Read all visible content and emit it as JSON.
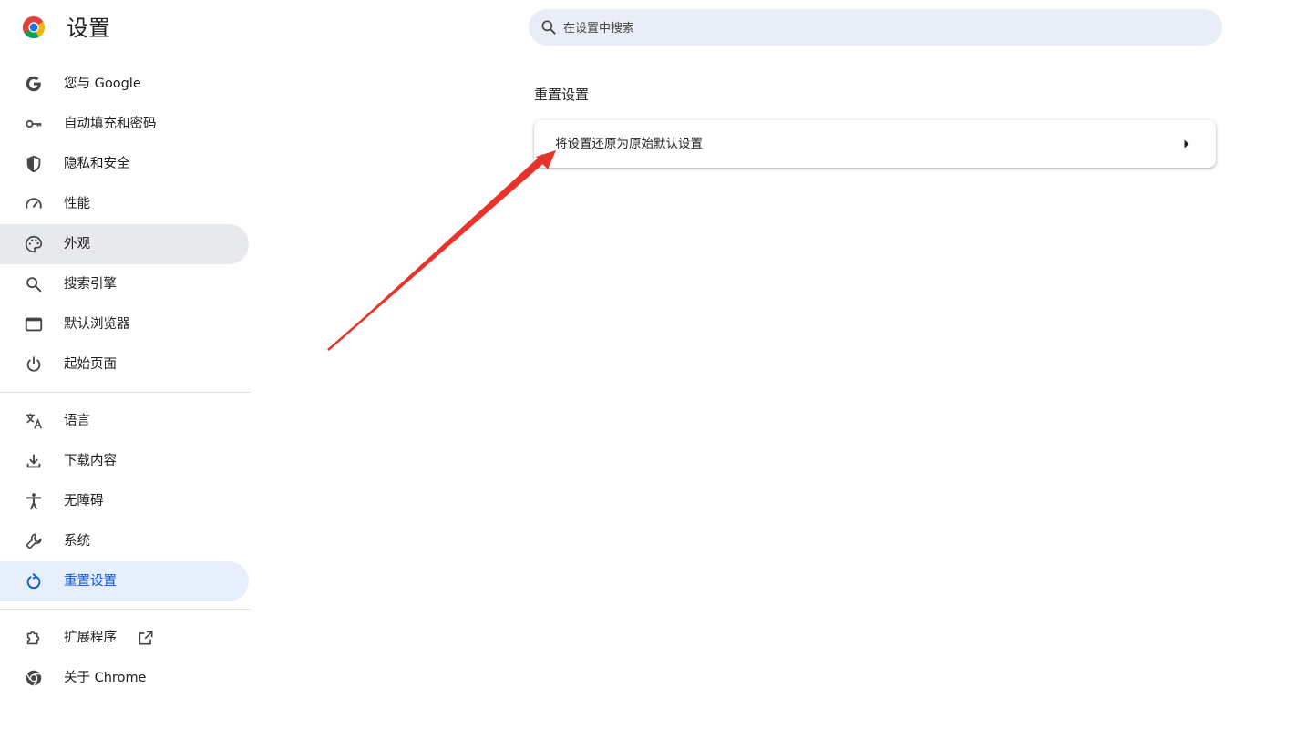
{
  "app": {
    "title": "设置"
  },
  "search": {
    "placeholder": "在设置中搜索",
    "value": ""
  },
  "sidebar": {
    "group1": [
      {
        "label": "您与 Google",
        "icon": "google-icon"
      },
      {
        "label": "自动填充和密码",
        "icon": "key-icon"
      },
      {
        "label": "隐私和安全",
        "icon": "shield-icon"
      },
      {
        "label": "性能",
        "icon": "speedometer-icon"
      },
      {
        "label": "外观",
        "icon": "palette-icon",
        "state": "hover"
      },
      {
        "label": "搜索引擎",
        "icon": "search-icon"
      },
      {
        "label": "默认浏览器",
        "icon": "browser-window-icon"
      },
      {
        "label": "起始页面",
        "icon": "power-icon"
      }
    ],
    "group2": [
      {
        "label": "语言",
        "icon": "translate-icon"
      },
      {
        "label": "下载内容",
        "icon": "download-icon"
      },
      {
        "label": "无障碍",
        "icon": "accessibility-icon"
      },
      {
        "label": "系统",
        "icon": "wrench-icon"
      },
      {
        "label": "重置设置",
        "icon": "reset-icon",
        "state": "active"
      }
    ],
    "group3": [
      {
        "label": "扩展程序",
        "icon": "puzzle-icon",
        "trailing_icon": "open-in-new-icon"
      },
      {
        "label": "关于 Chrome",
        "icon": "chrome-icon"
      }
    ]
  },
  "main": {
    "section_title": "重置设置",
    "rows": [
      {
        "label": "将设置还原为原始默认设置",
        "icon": "arrow-right-icon"
      }
    ]
  },
  "colors": {
    "accent": "#0b57d0",
    "active_bg": "#e7eefc",
    "hover_bg": "#e8e9ec",
    "search_bg": "#e9edf7",
    "annotation_arrow": "#e8332a"
  }
}
